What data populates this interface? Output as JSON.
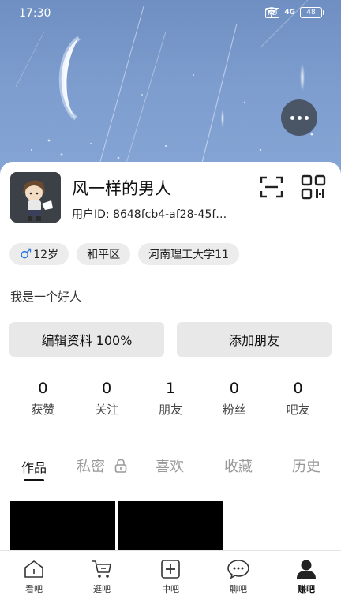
{
  "status_bar": {
    "time": "17:30",
    "network_badge": "HD",
    "signal_label": "4G",
    "battery_level": "48"
  },
  "profile": {
    "name": "风一样的男人",
    "user_id": "用户ID: 8648fcb4-af28-45f…",
    "tags": {
      "gender_icon": "♂",
      "age": "12岁",
      "district": "和平区",
      "school": "河南理工大学11"
    },
    "bio": "我是一个好人"
  },
  "actions": {
    "edit_profile": "编辑资料  100%",
    "add_friend": "添加朋友"
  },
  "stats": [
    {
      "value": "0",
      "label": "获赞"
    },
    {
      "value": "0",
      "label": "关注"
    },
    {
      "value": "1",
      "label": "朋友"
    },
    {
      "value": "0",
      "label": "粉丝"
    },
    {
      "value": "0",
      "label": "吧友"
    }
  ],
  "tabs": [
    "作品",
    "私密",
    "喜欢",
    "收藏",
    "历史"
  ],
  "nav": [
    {
      "label": "看吧",
      "icon": "home-icon"
    },
    {
      "label": "逛吧",
      "icon": "cart-icon"
    },
    {
      "label": "中吧",
      "icon": "plus-box-icon"
    },
    {
      "label": "聊吧",
      "icon": "chat-bubble-icon"
    },
    {
      "label": "赚吧",
      "icon": "person-icon"
    }
  ],
  "colors": {
    "accent_gender": "#2b78e4",
    "hero_sky": "#7d9dcf",
    "button_bg": "#e8e8e8"
  }
}
